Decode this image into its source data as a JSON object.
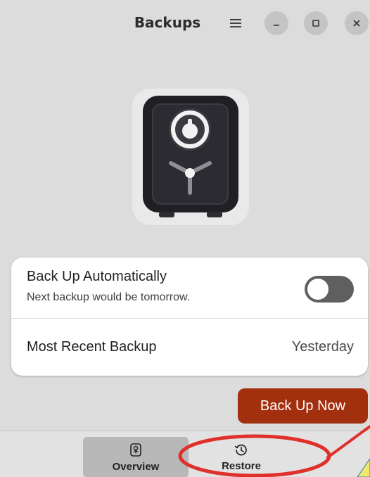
{
  "window": {
    "title": "Backups"
  },
  "header": {
    "menu_icon": "hamburger-menu-icon",
    "minimize_icon": "minimize-icon",
    "maximize_icon": "maximize-icon",
    "close_icon": "close-icon"
  },
  "hero": {
    "icon": "safe-vault-icon"
  },
  "settings": {
    "auto_backup": {
      "title": "Back Up Automatically",
      "subtitle": "Next backup would be tomorrow.",
      "enabled": false
    },
    "recent_backup": {
      "label": "Most Recent Backup",
      "value": "Yesterday"
    }
  },
  "actions": {
    "back_up_now_label": "Back Up Now"
  },
  "view_switcher": {
    "tabs": [
      {
        "label": "Overview",
        "icon": "vault-icon",
        "active": true
      },
      {
        "label": "Restore",
        "icon": "history-icon",
        "active": false
      }
    ]
  },
  "colors": {
    "accent": "#a2300f",
    "window_bg": "#dcdcdc",
    "card_bg": "#ffffff",
    "annotation": "#e0302a"
  }
}
